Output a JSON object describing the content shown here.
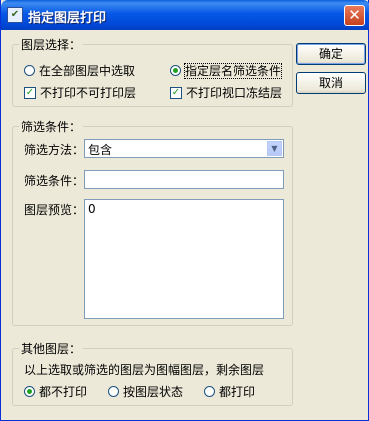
{
  "window": {
    "title": "指定图层打印",
    "close_glyph": "✕"
  },
  "layer_selection": {
    "legend": "图层选择：",
    "radio_all": "在全部图层中选取",
    "radio_filter": "指定层名筛选条件",
    "radio_selected": "radio_filter",
    "check_no_unprintable": "不打印不可打印层",
    "check_no_viewport_frozen": "不打印视口冻结层",
    "check_no_unprintable_checked": true,
    "check_no_viewport_frozen_checked": true
  },
  "buttons": {
    "ok": "确定",
    "cancel": "取消"
  },
  "filter": {
    "legend": "筛选条件：",
    "method_label": "筛选方法：",
    "method_value": "包含",
    "condition_label": "筛选条件：",
    "condition_value": "",
    "preview_label": "图层预览：",
    "preview_value": "0"
  },
  "other_layers": {
    "legend": "其他图层：",
    "description": "以上选取或筛选的图层为图幅图层，剩余图层",
    "opt_none": "都不打印",
    "opt_by_state": "按图层状态",
    "opt_all": "都打印",
    "selected": "opt_none"
  }
}
